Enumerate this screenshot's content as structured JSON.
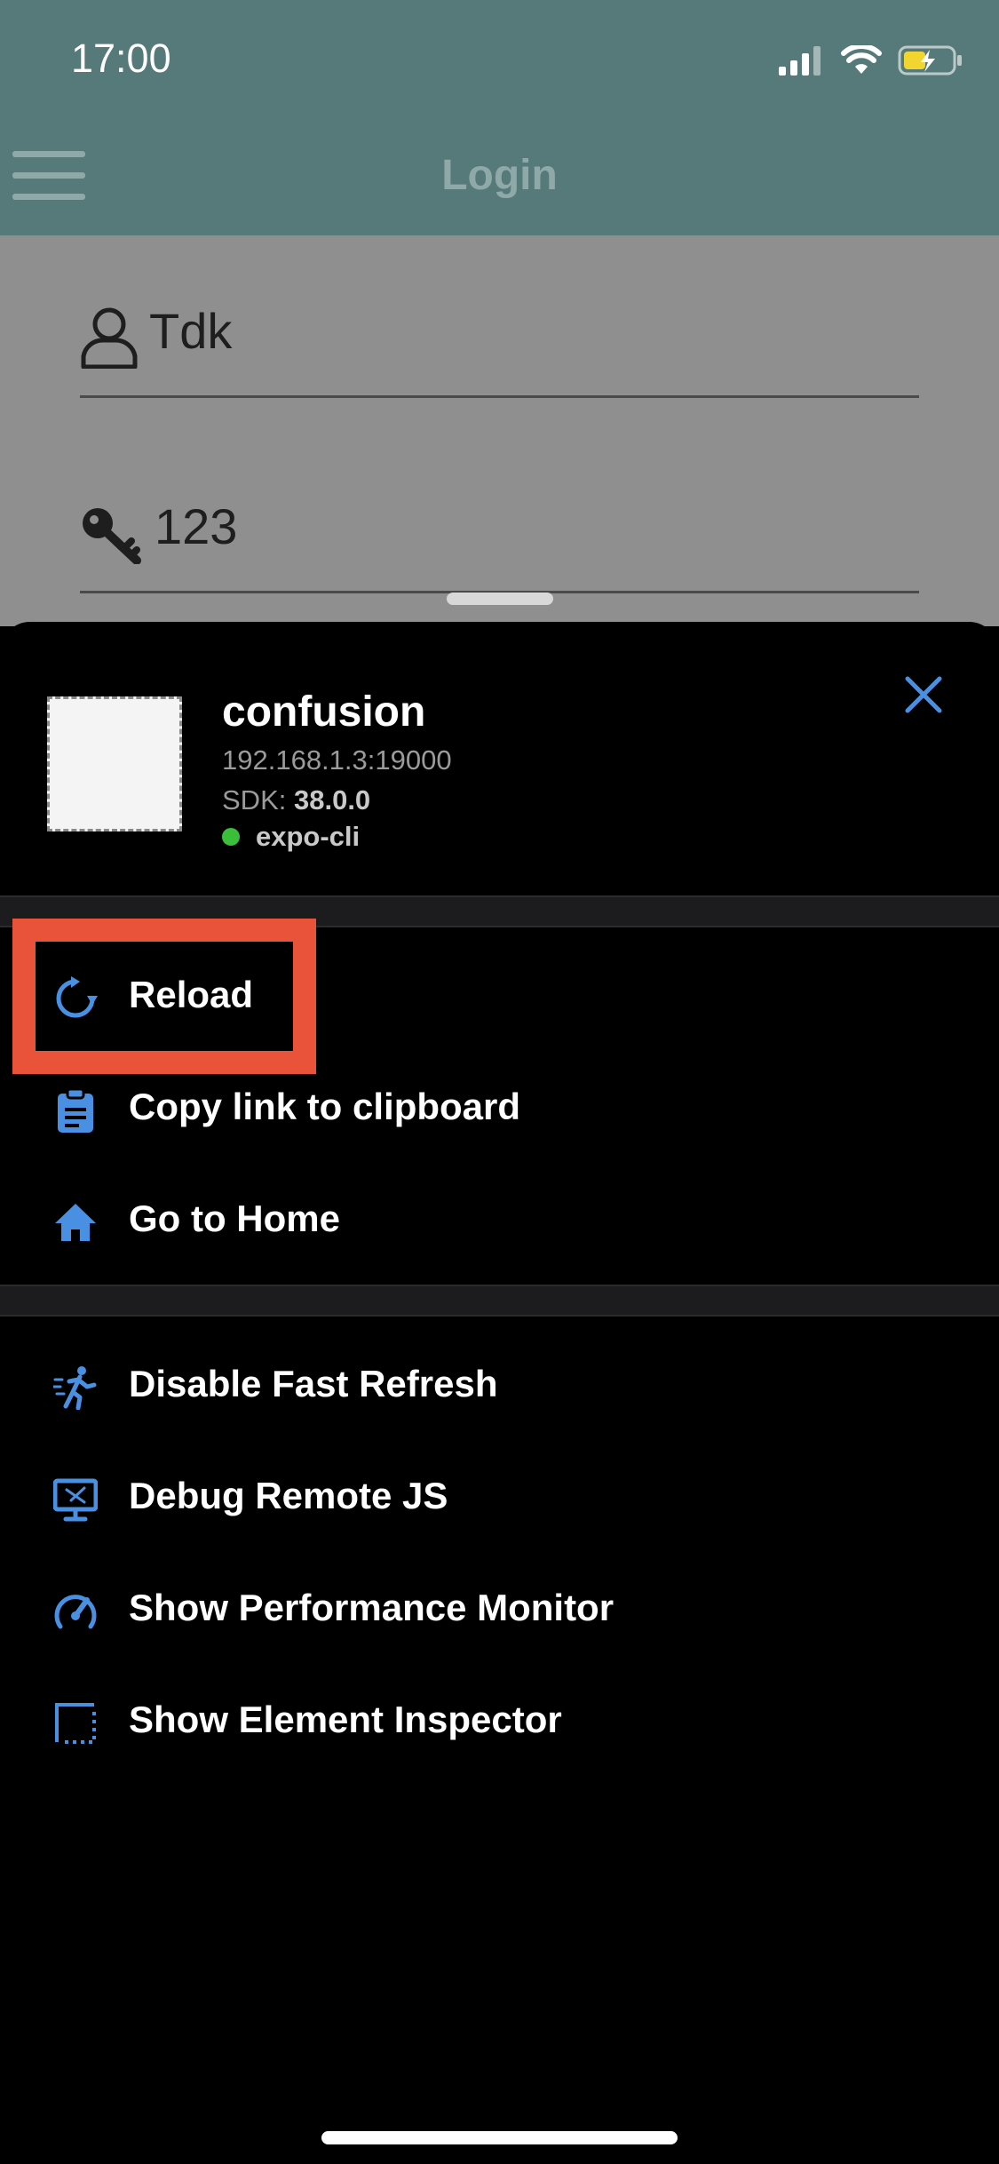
{
  "status_bar": {
    "time": "17:00"
  },
  "background_app": {
    "title": "Login",
    "username_value": "Tdk",
    "password_value": "123"
  },
  "dev_menu": {
    "app_name": "confusion",
    "host": "192.168.1.3:19000",
    "sdk_label": "SDK:",
    "sdk_version": "38.0.0",
    "runtime": "expo-cli",
    "section1": [
      {
        "label": "Reload",
        "icon": "reload-icon"
      },
      {
        "label": "Copy link to clipboard",
        "icon": "clipboard-icon"
      },
      {
        "label": "Go to Home",
        "icon": "home-icon"
      }
    ],
    "section2": [
      {
        "label": "Disable Fast Refresh",
        "icon": "running-man-icon"
      },
      {
        "label": "Debug Remote JS",
        "icon": "monitor-debug-icon"
      },
      {
        "label": "Show Performance Monitor",
        "icon": "speedometer-icon"
      },
      {
        "label": "Show Element Inspector",
        "icon": "inspector-icon"
      }
    ]
  },
  "colors": {
    "accent": "#4a90e2",
    "highlight": "#e9533a",
    "header": "#557a79",
    "status_dot": "#3bbf3b"
  }
}
